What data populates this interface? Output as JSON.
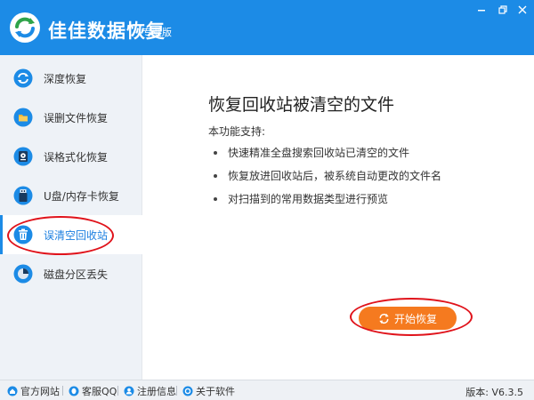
{
  "app": {
    "title": "佳佳数据恢复",
    "edition": "专业版"
  },
  "window_controls": [
    "minimize-icon",
    "restore-icon",
    "close-icon"
  ],
  "sidebar": {
    "items": [
      {
        "label": "深度恢复",
        "icon": "deep-scan-icon"
      },
      {
        "label": "误删文件恢复",
        "icon": "deleted-file-icon"
      },
      {
        "label": "误格式化恢复",
        "icon": "format-disk-icon"
      },
      {
        "label": "U盘/内存卡恢复",
        "icon": "usb-drive-icon"
      },
      {
        "label": "误清空回收站",
        "icon": "recycle-bin-icon",
        "active": true
      },
      {
        "label": "磁盘分区丢失",
        "icon": "partition-icon"
      }
    ]
  },
  "main": {
    "title": "恢复回收站被清空的文件",
    "subtitle": "本功能支持:",
    "features": [
      "快速精准全盘搜索回收站已清空的文件",
      "恢复放进回收站后，被系统自动更改的文件名",
      "对扫描到的常用数据类型进行预览"
    ],
    "start_button": "开始恢复"
  },
  "statusbar": {
    "links": [
      {
        "label": "官方网站",
        "icon": "home-icon"
      },
      {
        "label": "客服QQ",
        "icon": "qq-icon"
      },
      {
        "label": "注册信息",
        "icon": "user-icon"
      },
      {
        "label": "关于软件",
        "icon": "gear-icon"
      }
    ],
    "version": "版本: V6.3.5"
  },
  "colors": {
    "brand_blue": "#1c8be6",
    "accent_orange": "#f57a1f",
    "annotation_red": "#e0131b"
  }
}
